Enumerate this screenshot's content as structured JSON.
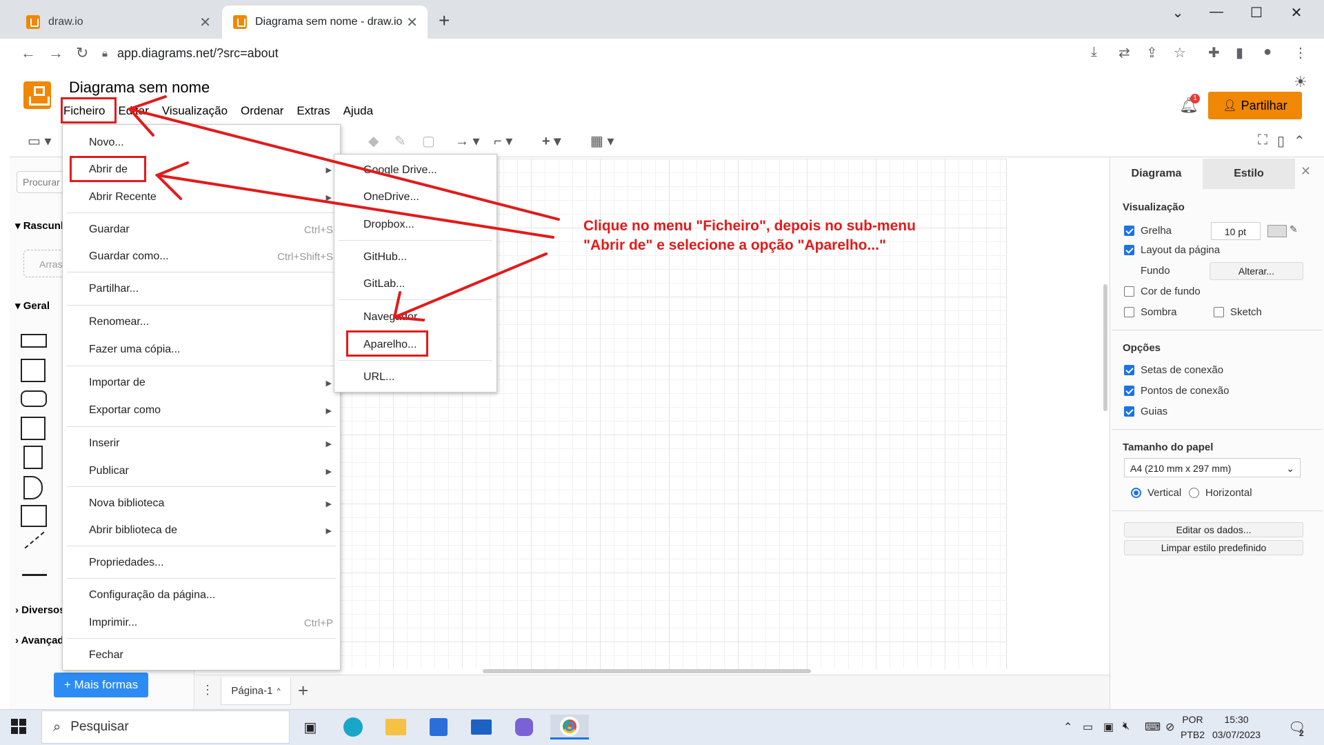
{
  "browser": {
    "tabs": [
      {
        "title": "draw.io"
      },
      {
        "title": "Diagrama sem nome - draw.io"
      }
    ],
    "url": "app.diagrams.net/?src=about"
  },
  "app": {
    "doc_title": "Diagrama sem nome",
    "menus": [
      "Ficheiro",
      "Editar",
      "Visualização",
      "Ordenar",
      "Extras",
      "Ajuda"
    ],
    "share_label": "Partilhar",
    "notification_count": "1",
    "accent_color": "#f08705"
  },
  "left_panel": {
    "search_placeholder": "Procurar",
    "sections": [
      "Rascunho",
      "Geral",
      "Diversos",
      "Avançado"
    ],
    "scratch_drop": "Arrastar",
    "more_shapes_label": "+ Mais formas"
  },
  "file_menu": {
    "items": [
      {
        "label": "Novo...",
        "shortcut": "",
        "submenu": false
      },
      {
        "label": "Abrir de",
        "shortcut": "",
        "submenu": true
      },
      {
        "label": "Abrir Recente",
        "shortcut": "",
        "submenu": true
      },
      {
        "label": "Guardar",
        "shortcut": "Ctrl+S",
        "submenu": false
      },
      {
        "label": "Guardar como...",
        "shortcut": "Ctrl+Shift+S",
        "submenu": false
      },
      {
        "label": "Partilhar...",
        "shortcut": "",
        "submenu": false
      },
      {
        "label": "Renomear...",
        "shortcut": "",
        "submenu": false
      },
      {
        "label": "Fazer uma cópia...",
        "shortcut": "",
        "submenu": false
      },
      {
        "label": "Importar de",
        "shortcut": "",
        "submenu": true
      },
      {
        "label": "Exportar como",
        "shortcut": "",
        "submenu": true
      },
      {
        "label": "Inserir",
        "shortcut": "",
        "submenu": true
      },
      {
        "label": "Publicar",
        "shortcut": "",
        "submenu": true
      },
      {
        "label": "Nova biblioteca",
        "shortcut": "",
        "submenu": true
      },
      {
        "label": "Abrir biblioteca de",
        "shortcut": "",
        "submenu": true
      },
      {
        "label": "Propriedades...",
        "shortcut": "",
        "submenu": false
      },
      {
        "label": "Configuração da página...",
        "shortcut": "",
        "submenu": false
      },
      {
        "label": "Imprimir...",
        "shortcut": "Ctrl+P",
        "submenu": false
      },
      {
        "label": "Fechar",
        "shortcut": "",
        "submenu": false
      }
    ]
  },
  "open_submenu": {
    "items": [
      "Google Drive...",
      "OneDrive...",
      "Dropbox...",
      "GitHub...",
      "GitLab...",
      "Navegador...",
      "Aparelho...",
      "URL..."
    ]
  },
  "annotation": {
    "line1": "Clique no menu \"Ficheiro\", depois no sub-menu",
    "line2": "\"Abrir de\" e selecione a opção \"Aparelho...\"",
    "color": "#e21a1a"
  },
  "right_panel": {
    "tabs": [
      "Diagrama",
      "Estilo"
    ],
    "view_heading": "Visualização",
    "grid_label": "Grelha",
    "grid_size": "10 pt",
    "page_layout_label": "Layout da página",
    "background_label": "Fundo",
    "change_button": "Alterar...",
    "bg_color_label": "Cor de fundo",
    "shadow_label": "Sombra",
    "sketch_label": "Sketch",
    "options_heading": "Opções",
    "options": [
      "Setas de conexão",
      "Pontos de conexão",
      "Guias"
    ],
    "paper_heading": "Tamanho do papel",
    "paper_size": "A4 (210 mm x 297 mm)",
    "orientation_vertical": "Vertical",
    "orientation_horizontal": "Horizontal",
    "edit_data_button": "Editar os dados...",
    "clear_style_button": "Limpar estilo predefinido"
  },
  "pages": {
    "current": "Página-1"
  },
  "taskbar": {
    "search_label": "Pesquisar",
    "lang_line1": "POR",
    "lang_line2": "PTB2",
    "time": "15:30",
    "date": "03/07/2023",
    "notifications": "2"
  }
}
